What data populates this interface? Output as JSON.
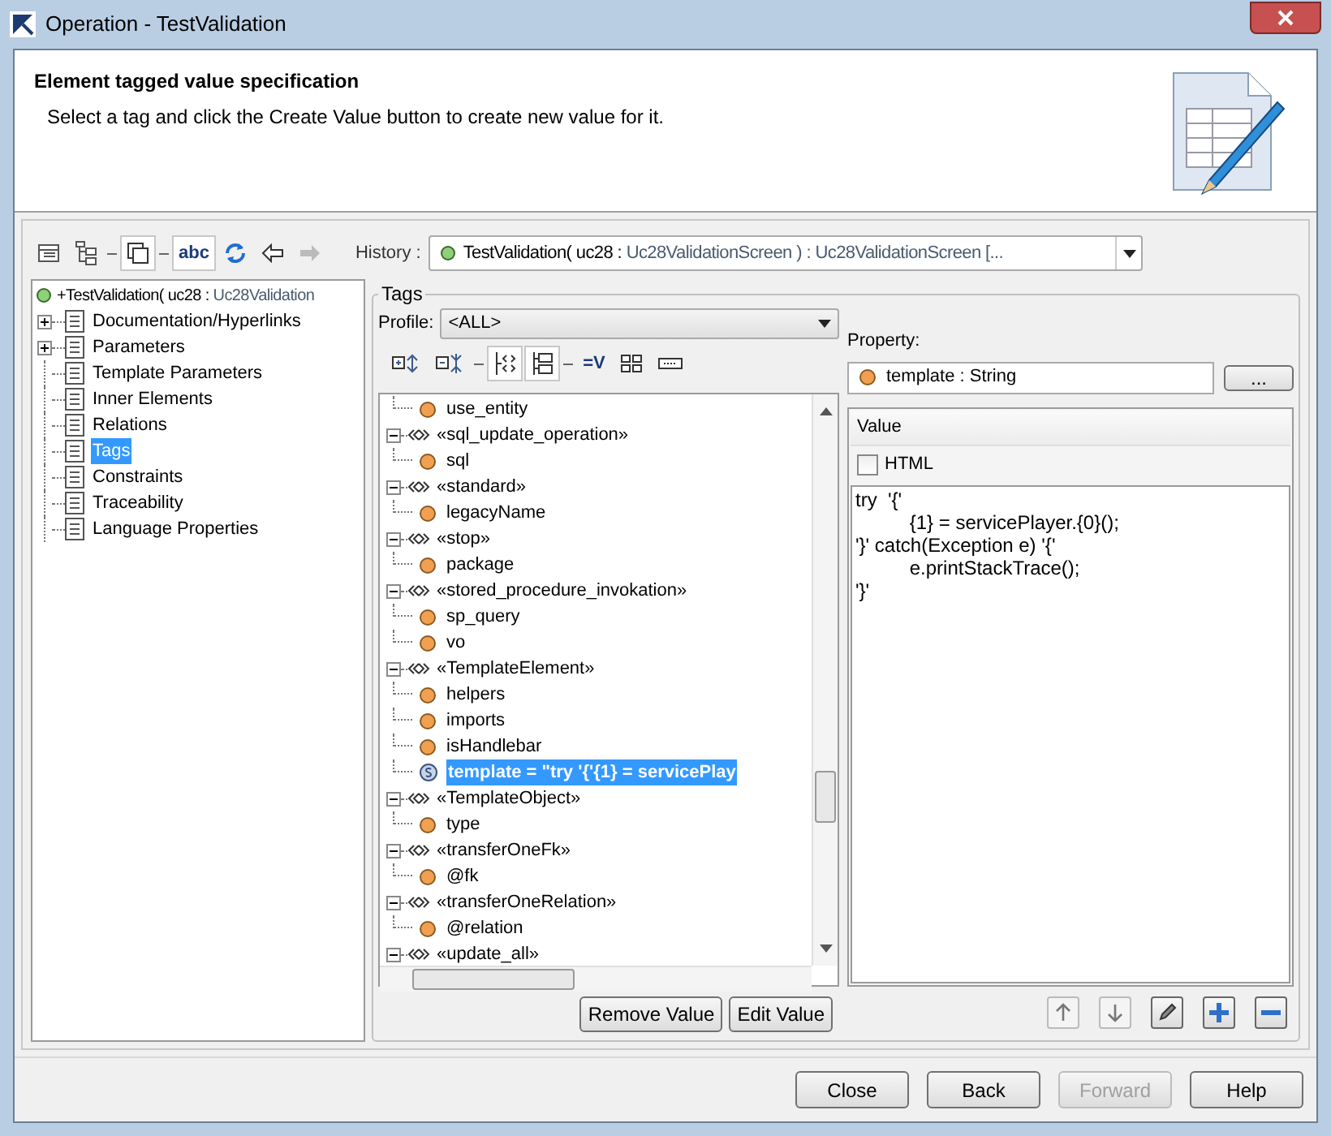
{
  "window": {
    "title": "Operation - TestValidation"
  },
  "header": {
    "title": "Element tagged value specification",
    "description": "Select a tag and click the Create Value button to create new value for it."
  },
  "toolbar": [
    {
      "kind": "table",
      "pressed": false
    },
    {
      "kind": "tree",
      "pressed": false
    },
    {
      "kind": "separator"
    },
    {
      "kind": "windows",
      "pressed": true
    },
    {
      "kind": "separator"
    },
    {
      "kind": "text",
      "label": "abc",
      "pressed": true
    },
    {
      "kind": "refresh",
      "pressed": false
    },
    {
      "kind": "back",
      "pressed": false,
      "disabled": false
    },
    {
      "kind": "forward",
      "pressed": false,
      "disabled": true
    }
  ],
  "history": {
    "label": "History :",
    "value": "TestValidation( uc28 : ",
    "value_type": "Uc28ValidationScreen ) : Uc28ValidationScreen [..."
  },
  "sidebar": {
    "root": {
      "label": "+TestValidation( uc28 : ",
      "type": "Uc28Validation"
    },
    "items": [
      {
        "label": "Documentation/Hyperlinks",
        "expandable": true,
        "selected": false
      },
      {
        "label": "Parameters",
        "expandable": true,
        "selected": false
      },
      {
        "label": "Template Parameters",
        "expandable": false,
        "selected": false
      },
      {
        "label": "Inner Elements",
        "expandable": false,
        "selected": false
      },
      {
        "label": "Relations",
        "expandable": false,
        "selected": false
      },
      {
        "label": "Tags",
        "expandable": false,
        "selected": true
      },
      {
        "label": "Constraints",
        "expandable": false,
        "selected": false
      },
      {
        "label": "Traceability",
        "expandable": false,
        "selected": false
      },
      {
        "label": "Language Properties",
        "expandable": false,
        "selected": false
      }
    ]
  },
  "tags": {
    "title": "Tags",
    "profile_label": "Profile:",
    "profile": "<ALL>",
    "tag_toolbar": [
      {
        "kind": "expand",
        "pressed": false
      },
      {
        "kind": "collapse",
        "pressed": false
      },
      {
        "kind": "separator"
      },
      {
        "kind": "stereo",
        "pressed": true
      },
      {
        "kind": "hierarchy",
        "pressed": true
      },
      {
        "kind": "separator"
      },
      {
        "kind": "text",
        "label": "=V",
        "pressed": false
      },
      {
        "kind": "grid",
        "pressed": false
      },
      {
        "kind": "field",
        "pressed": false
      }
    ],
    "tree": [
      {
        "children": [
          {
            "label": "use_entity",
            "kind": "tag",
            "selected": false
          }
        ]
      },
      {
        "stereotype": "«sql_update_operation»",
        "expanded": true,
        "children": [
          {
            "label": "sql",
            "kind": "tag",
            "selected": false
          }
        ]
      },
      {
        "stereotype": "«standard»",
        "expanded": true,
        "children": [
          {
            "label": "legacyName",
            "kind": "tag",
            "selected": false
          }
        ]
      },
      {
        "stereotype": "«stop»",
        "expanded": true,
        "children": [
          {
            "label": "package",
            "kind": "tag",
            "selected": false
          }
        ]
      },
      {
        "stereotype": "«stored_procedure_invokation»",
        "expanded": true,
        "children": [
          {
            "label": "sp_query",
            "kind": "tag",
            "selected": false
          },
          {
            "label": "vo",
            "kind": "tag",
            "selected": false
          }
        ]
      },
      {
        "stereotype": "«TemplateElement»",
        "expanded": true,
        "children": [
          {
            "label": "helpers",
            "kind": "tag",
            "selected": false
          },
          {
            "label": "imports",
            "kind": "tag",
            "selected": false
          },
          {
            "label": "isHandlebar",
            "kind": "tag",
            "selected": false
          },
          {
            "label": "template = \"try  '{'{1} = servicePlay",
            "kind": "value",
            "selected": true
          }
        ]
      },
      {
        "stereotype": "«TemplateObject»",
        "expanded": true,
        "children": [
          {
            "label": "type",
            "kind": "tag",
            "selected": false
          }
        ]
      },
      {
        "stereotype": "«transferOneFk»",
        "expanded": true,
        "children": [
          {
            "label": "@fk",
            "kind": "tag",
            "selected": false
          }
        ]
      },
      {
        "stereotype": "«transferOneRelation»",
        "expanded": true,
        "children": [
          {
            "label": "@relation",
            "kind": "tag",
            "selected": false
          }
        ]
      },
      {
        "stereotype": "«update_all»",
        "expanded": true
      }
    ],
    "buttons": [
      "Remove Value",
      "Edit Value"
    ]
  },
  "property": {
    "label": "Property:",
    "value": "template : String",
    "browse": "...",
    "value_header": "Value",
    "html_label": "HTML",
    "html_checked": false,
    "value_lines": [
      "try  '{'",
      "\t\t{1} = servicePlayer.{0}();",
      "'}' catch(Exception e) '{'",
      "\t\te.printStackTrace();",
      "'}'"
    ],
    "actions": [
      {
        "kind": "up",
        "disabled": true
      },
      {
        "kind": "down",
        "disabled": true
      },
      {
        "kind": "edit",
        "disabled": false
      },
      {
        "kind": "add",
        "disabled": false
      },
      {
        "kind": "remove",
        "disabled": false
      }
    ]
  },
  "footer": [
    {
      "label": "Close",
      "disabled": false
    },
    {
      "label": "Back",
      "disabled": false
    },
    {
      "label": "Forward",
      "disabled": true
    },
    {
      "label": "Help",
      "disabled": false
    }
  ]
}
